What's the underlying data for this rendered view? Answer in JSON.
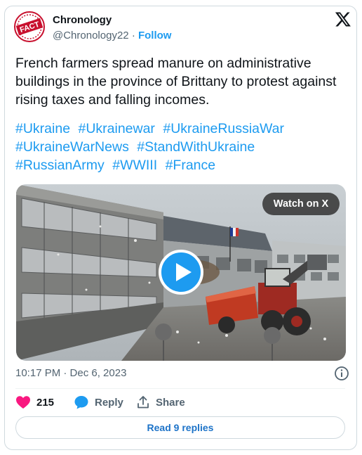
{
  "author": {
    "name": "Chronology",
    "handle": "@Chronology22",
    "separator": "·",
    "follow_label": "Follow",
    "avatar_text": "FACT"
  },
  "post": {
    "text": "French farmers spread manure on administrative buildings in the province of Brittany to protest against rising taxes and falling incomes.",
    "hashtags": [
      "#Ukraine",
      "#Ukrainewar",
      "#UkraineRussiaWar",
      "#UkraineWarNews",
      "#StandWithUkraine",
      "#RussianArmy",
      "#WWIII",
      "#France"
    ],
    "timestamp": "10:17 PM · Dec 6, 2023"
  },
  "media": {
    "watch_label": "Watch on X",
    "type": "video"
  },
  "actions": {
    "likes": "215",
    "reply_label": "Reply",
    "share_label": "Share",
    "read_replies_label": "Read 9 replies"
  },
  "colors": {
    "accent": "#1d9bf0",
    "like": "#f91880",
    "text": "#0f1419",
    "muted": "#536471"
  }
}
